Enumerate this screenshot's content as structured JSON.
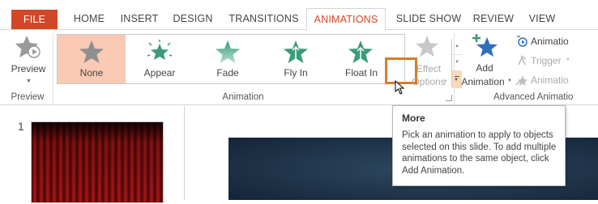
{
  "tabs": [
    {
      "label": "FILE"
    },
    {
      "label": "HOME"
    },
    {
      "label": "INSERT"
    },
    {
      "label": "DESIGN"
    },
    {
      "label": "TRANSITIONS"
    },
    {
      "label": "ANIMATIONS"
    },
    {
      "label": "SLIDE SHOW"
    },
    {
      "label": "REVIEW"
    },
    {
      "label": "VIEW"
    }
  ],
  "active_tab": "ANIMATIONS",
  "preview": {
    "button_label": "Preview",
    "group_label": "Preview"
  },
  "animation_gallery": {
    "items": [
      {
        "label": "None",
        "icon": "star-none-icon",
        "selected": true
      },
      {
        "label": "Appear",
        "icon": "star-appear-icon",
        "selected": false
      },
      {
        "label": "Fade",
        "icon": "star-fade-icon",
        "selected": false
      },
      {
        "label": "Fly In",
        "icon": "star-fly-in-icon",
        "selected": false
      },
      {
        "label": "Float In",
        "icon": "star-float-in-icon",
        "selected": false
      }
    ],
    "group_label": "Animation"
  },
  "effect_options": {
    "line1": "Effect",
    "line2": "Options"
  },
  "advanced": {
    "add_animation_line1": "Add",
    "add_animation_line2": "Animation",
    "animation_pane": "Animatio",
    "trigger": "Trigger",
    "animation_painter": "Animatio",
    "group_label": "Advanced Animatio"
  },
  "slide_number": "1",
  "tooltip": {
    "title": "More",
    "body": "Pick an animation to apply to objects selected on this slide.  To add multiple animations to the same object, click Add Animation."
  },
  "colors": {
    "accent": "#d24726",
    "selected_item": "#f9c9b4",
    "highlight_box": "#d97b2a",
    "star_gray": "#9a9a9a",
    "star_green": "#3b9b7a",
    "star_blue": "#2f6fba"
  }
}
